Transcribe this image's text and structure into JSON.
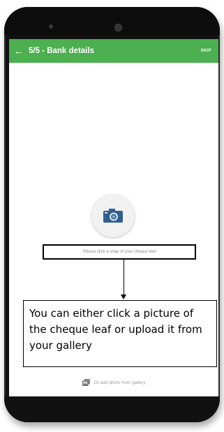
{
  "appbar": {
    "back_icon": "arrow-left-icon",
    "title": "5/5 - Bank details",
    "skip_label": "SKIP"
  },
  "camera": {
    "icon": "camera-icon"
  },
  "snap_hint": "Please click a snap of your cheque leaf",
  "callout": "You can either click a picture of the cheque leaf or upload it from your gallery",
  "gallery": {
    "icon": "photo-gallery-icon",
    "label": "Or add photo from gallery"
  },
  "colors": {
    "appbar": "#4caf50",
    "camera_body": "#2f5f8f",
    "phone_body": "#111111"
  }
}
